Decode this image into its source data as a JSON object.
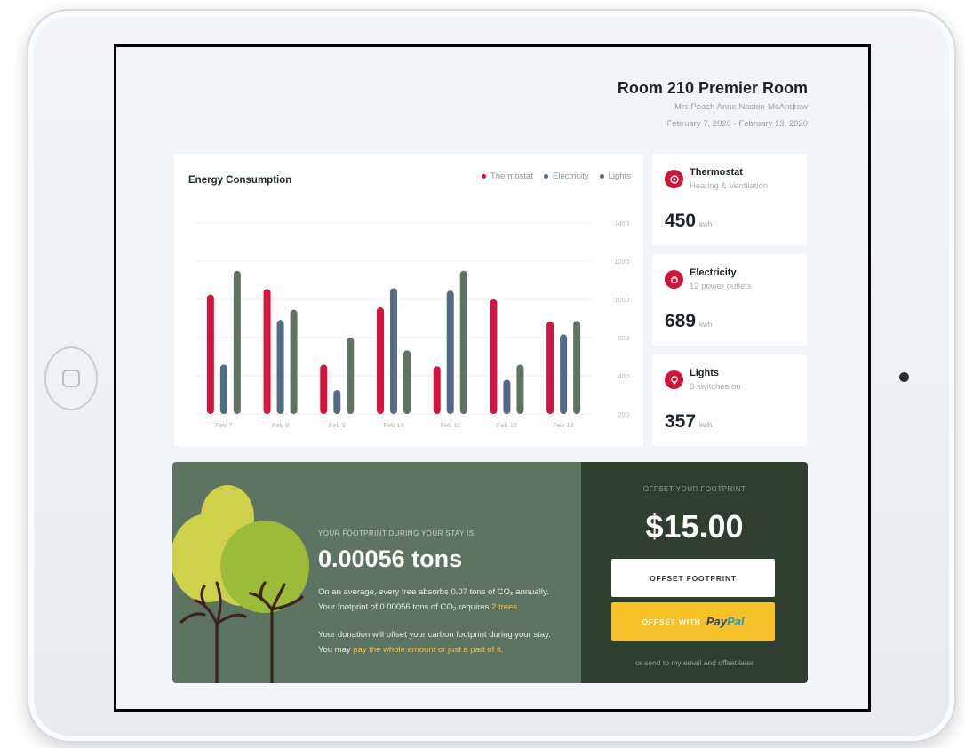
{
  "header": {
    "room": "Room 210 Premier Room",
    "guest": "Mrs Peach Anne Nacion-McAndrew",
    "dates": "February 7, 2020 - February 13, 2020"
  },
  "colors": {
    "thermostat": "#d4143c",
    "electricity": "#516a85",
    "lights": "#5e7463",
    "panel_dark": "#2e3f30",
    "accent_yellow": "#f6c029"
  },
  "chart": {
    "title": "Energy Consumption",
    "legend": [
      "Thermostat",
      "Electricity",
      "Lights"
    ]
  },
  "chart_data": {
    "type": "bar",
    "title": "Energy Consumption",
    "categories": [
      "Feb 7",
      "Feb 8",
      "Feb 9",
      "Feb 10",
      "Feb 11",
      "Feb 12",
      "Feb 13"
    ],
    "y_ticks": [
      "1400",
      "1200",
      "1000",
      "800",
      "400",
      "200"
    ],
    "ylim": [
      200,
      1400
    ],
    "grid": true,
    "legend_position": "top-right",
    "series": [
      {
        "name": "Thermostat",
        "color": "#d4143c",
        "values": [
          950,
          985,
          510,
          870,
          500,
          920,
          780
        ]
      },
      {
        "name": "Electricity",
        "color": "#516a85",
        "values": [
          510,
          790,
          350,
          990,
          975,
          415,
          700
        ]
      },
      {
        "name": "Lights",
        "color": "#5e7463",
        "values": [
          1100,
          855,
          680,
          600,
          1100,
          510,
          785
        ]
      }
    ]
  },
  "stats": [
    {
      "name": "Thermostat",
      "sub": "Heating & Ventilation",
      "value": "450",
      "unit": "kwh",
      "icon": "thermostat-icon"
    },
    {
      "name": "Electricity",
      "sub": "12 power outlets",
      "value": "689",
      "unit": "kwh",
      "icon": "plug-icon"
    },
    {
      "name": "Lights",
      "sub": "8 switches on",
      "value": "357",
      "unit": "kwh",
      "icon": "bulb-icon"
    }
  ],
  "footprint": {
    "label": "YOUR FOOTPRINT DURING YOUR STAY IS",
    "value": "0.00056 tons",
    "text1_a": "On an average, every tree absorbs 0.07 tons of CO₂ annually. Your footprint of 0.00056 tons of CO₂ requires ",
    "text1_link": "2 trees.",
    "text2_a": "Your donation will offset your carbon footprint during your stay. You may ",
    "text2_link": "pay the whole amount or just a part of it."
  },
  "offset": {
    "label": "OFFSET YOUR FOOTPRINT",
    "price": "$15.00",
    "button": "OFFSET FOOTPRINT",
    "paypal_button": "OFFSET WITH",
    "paypal_logo_a": "Pay",
    "paypal_logo_b": "Pal",
    "later": "or send to my email and offset later"
  }
}
